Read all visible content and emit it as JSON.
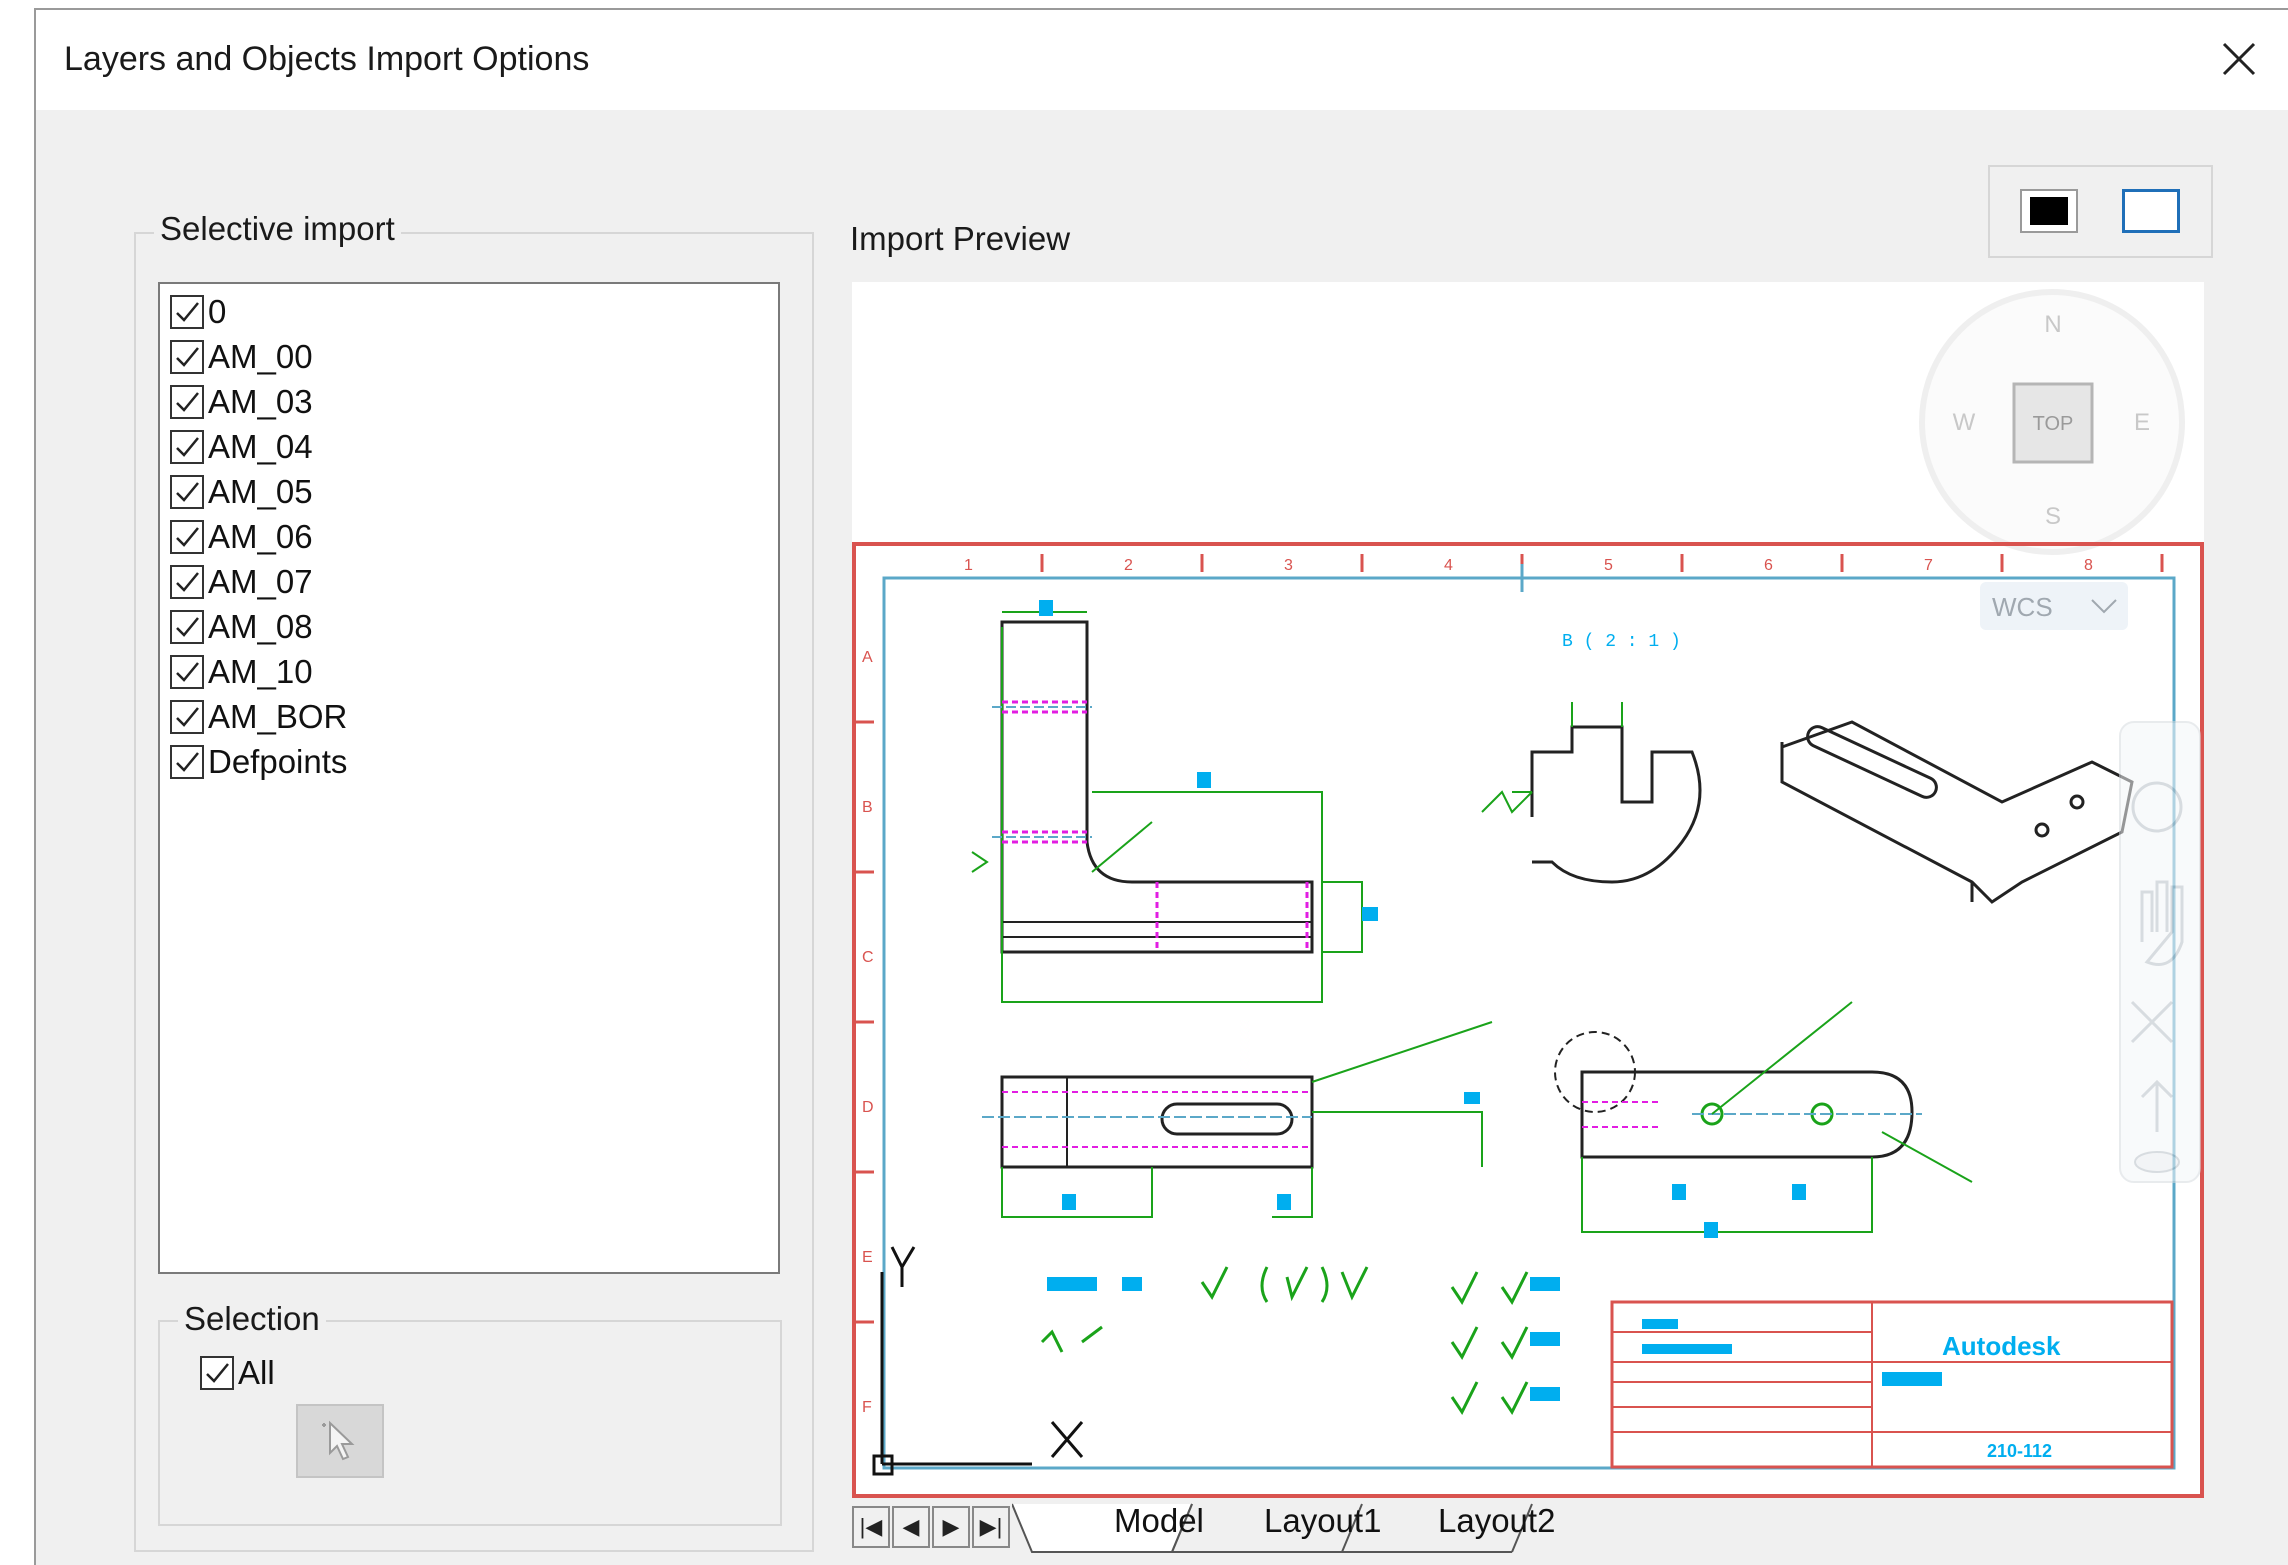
{
  "dialog": {
    "title": "Layers and Objects Import Options"
  },
  "selective_import": {
    "label": "Selective import",
    "layers": [
      {
        "name": "0",
        "checked": true
      },
      {
        "name": "AM_00",
        "checked": true
      },
      {
        "name": "AM_03",
        "checked": true
      },
      {
        "name": "AM_04",
        "checked": true
      },
      {
        "name": "AM_05",
        "checked": true
      },
      {
        "name": "AM_06",
        "checked": true
      },
      {
        "name": "AM_07",
        "checked": true
      },
      {
        "name": "AM_08",
        "checked": true
      },
      {
        "name": "AM_10",
        "checked": true
      },
      {
        "name": "AM_BOR",
        "checked": true
      },
      {
        "name": "Defpoints",
        "checked": true
      }
    ]
  },
  "selection": {
    "label": "Selection",
    "all_label": "All",
    "all_checked": true
  },
  "preview": {
    "label": "Import Preview",
    "viewcube": {
      "north": "N",
      "south": "S",
      "east": "E",
      "west": "W",
      "face": "TOP"
    },
    "wcs_label": "WCS",
    "tabs": [
      "Model",
      "Layout1",
      "Layout2"
    ],
    "active_tab": "Model",
    "ruler_top": [
      "1",
      "2",
      "3",
      "4",
      "5",
      "6",
      "7",
      "8"
    ],
    "ruler_side": [
      "A",
      "B",
      "C",
      "D",
      "E",
      "F"
    ],
    "drawing_note": "B ( 2 : 1 )",
    "title_block_brand": "Autodesk",
    "title_block_code": "210-112"
  },
  "colors": {
    "border_red": "#d9534f",
    "frame_blue": "#5ba8c8",
    "dim_green": "#1aa31a",
    "hidden_magenta": "#e21de2",
    "tag_cyan": "#00aeef"
  }
}
